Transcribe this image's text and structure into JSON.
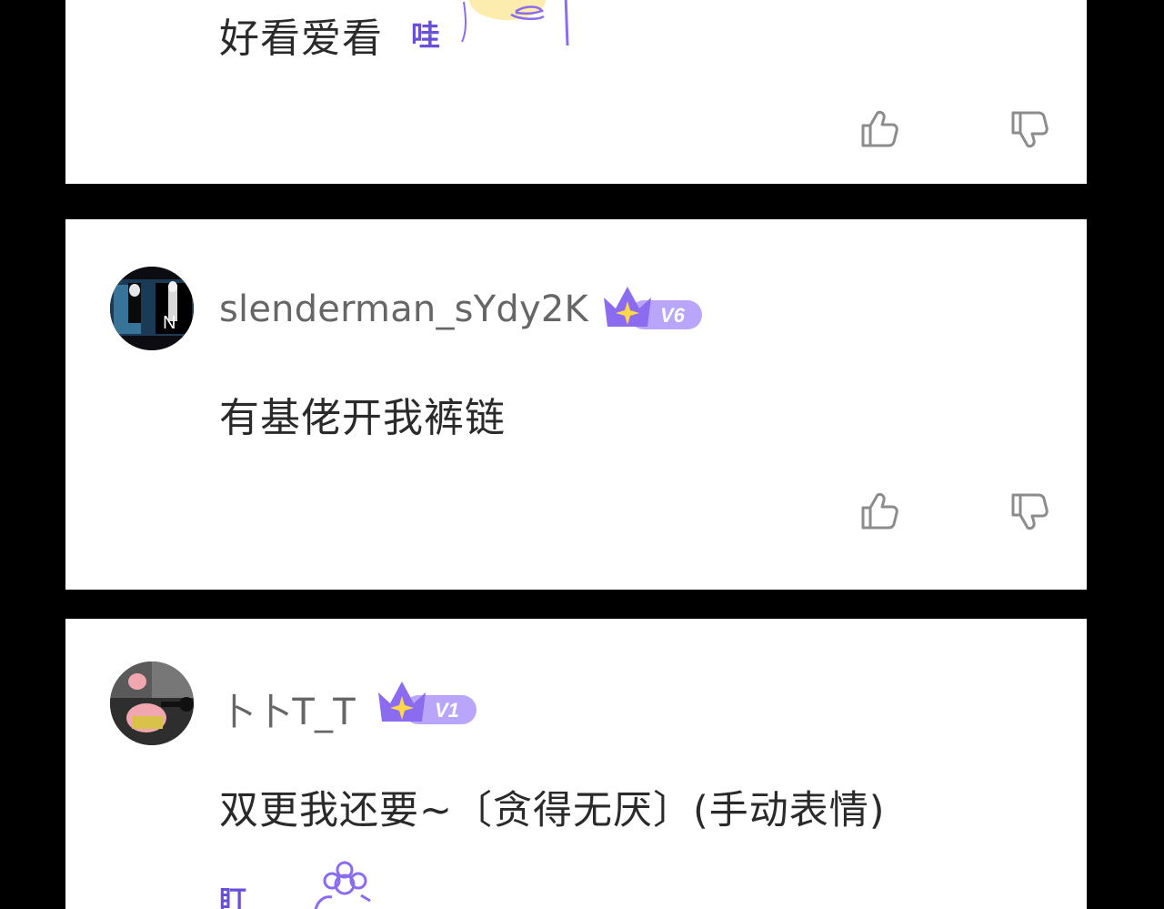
{
  "comments": [
    {
      "text": "好看爱看",
      "sticker": "wa-sticker-icon",
      "sticker_text": "哇"
    },
    {
      "username": "slenderman_sYdy2K",
      "vip_level": "V6",
      "avatar": "slenderman-avatar",
      "text": "有基佬开我裤链"
    },
    {
      "username": "卜卜T_T",
      "vip_level": "V1",
      "avatar": "patrick-star-avatar",
      "text": "双更我还要~〔贪得无厌〕(手动表情)",
      "sticker": "flower-sticker-icon",
      "sticker_text": "盯"
    }
  ],
  "icons": {
    "like": "thumbs-up-icon",
    "dislike": "thumbs-down-icon",
    "vip": "crown-badge-icon"
  },
  "colors": {
    "vip_purple": "#8b6cf0",
    "vip_light": "#b9a6fb",
    "star": "#ffd84a",
    "icon_gray": "#8c8c8c"
  }
}
